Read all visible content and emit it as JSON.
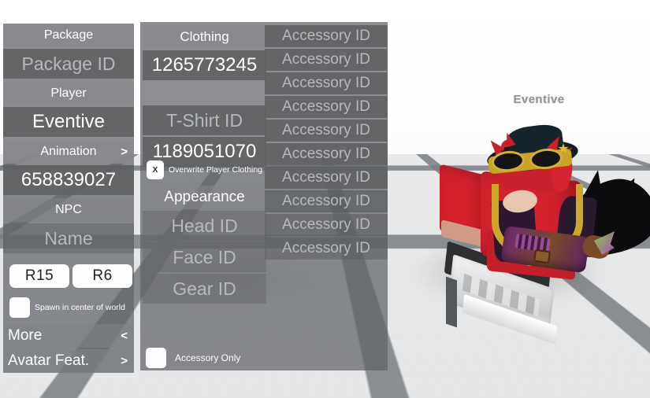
{
  "scene": {
    "nameplate": "Eventive",
    "background": "roblox-baseplate",
    "ground_color": "#e2e3e5",
    "grid_color": "#7a7e82"
  },
  "left_panel": {
    "rows": [
      {
        "name": "package-label",
        "text": "Package",
        "style": "label",
        "size": 16
      },
      {
        "name": "package-id-input",
        "text": "Package ID",
        "style": "ghost",
        "size": 23
      },
      {
        "name": "player-label",
        "text": "Player",
        "style": "label",
        "size": 16
      },
      {
        "name": "player-name-input",
        "text": "Eventive",
        "style": "val",
        "size": 24
      },
      {
        "name": "animation-label",
        "text": "Animation",
        "style": "label",
        "size": 16,
        "arrow": ">"
      },
      {
        "name": "animation-id-input",
        "text": "658839027",
        "style": "val",
        "size": 24
      },
      {
        "name": "npc-label",
        "text": "NPC",
        "style": "label",
        "size": 16
      },
      {
        "name": "npc-name-input",
        "text": "Name",
        "style": "ghost",
        "size": 23
      }
    ],
    "rig_buttons": [
      {
        "name": "rig-r15-button",
        "text": "R15"
      },
      {
        "name": "rig-r6-button",
        "text": "R6"
      }
    ],
    "spawn_checkbox": {
      "label": "Spawn in center of world",
      "checked": false,
      "mark": ""
    },
    "nav_rows": [
      {
        "name": "more-row",
        "text": "More",
        "arrow": "<"
      },
      {
        "name": "avatar-feat-row",
        "text": "Avatar Feat.",
        "arrow": ">"
      }
    ]
  },
  "middle_panel": {
    "rows": [
      {
        "name": "clothing-label",
        "text": "Clothing",
        "style": "label",
        "size": 17
      },
      {
        "name": "shirt-id-input",
        "text": "1265773245",
        "style": "val",
        "size": 24
      },
      {
        "name": "t-shirt-id-input",
        "text": "T-Shirt ID",
        "style": "ghost",
        "size": 23
      },
      {
        "name": "pants-id-input",
        "text": "1189051070",
        "style": "val",
        "size": 24
      }
    ],
    "overwrite_checkbox": {
      "label": "Overwrite Player Clothing",
      "checked": true,
      "mark": "X"
    },
    "appearance_label": "Appearance",
    "appearance_rows": [
      {
        "name": "head-id-input",
        "text": "Head ID",
        "style": "ghost",
        "size": 23
      },
      {
        "name": "face-id-input",
        "text": "Face ID",
        "style": "ghost",
        "size": 23
      },
      {
        "name": "gear-id-input",
        "text": "Gear ID",
        "style": "ghost",
        "size": 23
      }
    ],
    "accessory_only_checkbox": {
      "label": "Accessory Only",
      "checked": false,
      "mark": ""
    }
  },
  "accessory_panel": {
    "placeholder": "Accessory ID",
    "rows": [
      {
        "name": "accessory-id-input-1",
        "text": "Accessory ID"
      },
      {
        "name": "accessory-id-input-2",
        "text": "Accessory ID"
      },
      {
        "name": "accessory-id-input-3",
        "text": "Accessory ID"
      },
      {
        "name": "accessory-id-input-4",
        "text": "Accessory ID"
      },
      {
        "name": "accessory-id-input-5",
        "text": "Accessory ID"
      },
      {
        "name": "accessory-id-input-6",
        "text": "Accessory ID"
      },
      {
        "name": "accessory-id-input-7",
        "text": "Accessory ID"
      },
      {
        "name": "accessory-id-input-8",
        "text": "Accessory ID"
      },
      {
        "name": "accessory-id-input-9",
        "text": "Accessory ID"
      },
      {
        "name": "accessory-id-input-10",
        "text": "Accessory ID"
      }
    ]
  }
}
